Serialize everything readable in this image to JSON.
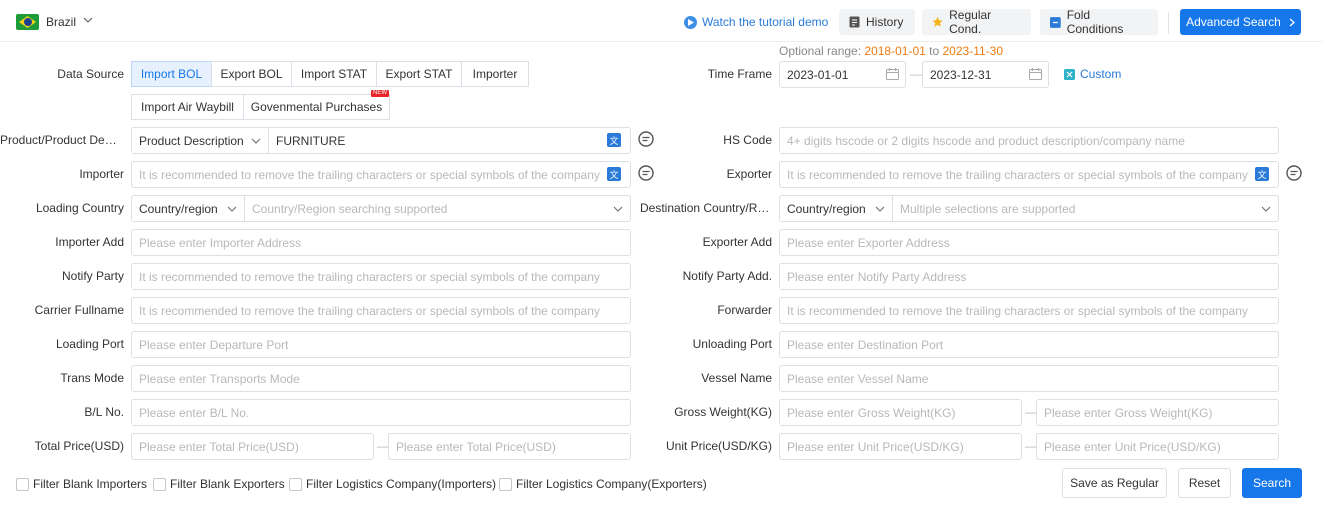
{
  "header": {
    "country": "Brazil",
    "tutorial_link": "Watch the tutorial demo",
    "history_label": "History",
    "regular_cond_label": "Regular Cond.",
    "fold_conditions_label": "Fold Conditions",
    "advanced_search_label": "Advanced Search"
  },
  "colors": {
    "primary": "#1677ea",
    "accent_orange": "#ee7b12",
    "active_bg": "#e6f1fd"
  },
  "data_source": {
    "label": "Data Source",
    "options": [
      "Import BOL",
      "Export BOL",
      "Import STAT",
      "Export STAT",
      "Importer",
      "Import Air Waybill",
      "Govenmental Purchases"
    ],
    "selected": "Import BOL",
    "new_badge": "NEW"
  },
  "time_frame": {
    "label": "Time Frame",
    "optional_label": "Optional range:",
    "range_start": "2018-01-01",
    "range_to": "to",
    "range_end": "2023-11-30",
    "start": "2023-01-01",
    "end": "2023-12-31",
    "dash": "—",
    "custom_label": "Custom"
  },
  "fields": {
    "product": {
      "label": "Product/Product Description",
      "select": "Product Description",
      "value": "FURNITURE"
    },
    "hs_code": {
      "label": "HS Code",
      "placeholder": "4+ digits hscode or 2 digits hscode and product description/company name"
    },
    "importer": {
      "label": "Importer",
      "placeholder": "It is recommended to remove the trailing characters or special symbols of the company"
    },
    "exporter": {
      "label": "Exporter",
      "placeholder": "It is recommended to remove the trailing characters or special symbols of the company"
    },
    "loading_country": {
      "label": "Loading Country",
      "select": "Country/region",
      "placeholder": "Country/Region searching supported"
    },
    "destination_country": {
      "label": "Destination Country/Region",
      "select": "Country/region",
      "placeholder": "Multiple selections are supported"
    },
    "importer_add": {
      "label": "Importer Add",
      "placeholder": "Please enter Importer Address"
    },
    "exporter_add": {
      "label": "Exporter Add",
      "placeholder": "Please enter Exporter Address"
    },
    "notify_party": {
      "label": "Notify Party",
      "placeholder": "It is recommended to remove the trailing characters or special symbols of the company"
    },
    "notify_party_add": {
      "label": "Notify Party Add.",
      "placeholder": "Please enter Notify Party Address"
    },
    "carrier_fullname": {
      "label": "Carrier Fullname",
      "placeholder": "It is recommended to remove the trailing characters or special symbols of the company"
    },
    "forwarder": {
      "label": "Forwarder",
      "placeholder": "It is recommended to remove the trailing characters or special symbols of the company"
    },
    "loading_port": {
      "label": "Loading Port",
      "placeholder": "Please enter Departure Port"
    },
    "unloading_port": {
      "label": "Unloading Port",
      "placeholder": "Please enter Destination Port"
    },
    "trans_mode": {
      "label": "Trans Mode",
      "placeholder": "Please enter Transports Mode"
    },
    "vessel_name": {
      "label": "Vessel Name",
      "placeholder": "Please enter Vessel Name"
    },
    "bl_no": {
      "label": "B/L No.",
      "placeholder": "Please enter B/L No."
    },
    "gross_weight": {
      "label": "Gross Weight(KG)",
      "placeholder": "Please enter Gross Weight(KG)"
    },
    "total_price": {
      "label": "Total Price(USD)",
      "placeholder": "Please enter Total Price(USD)"
    },
    "unit_price": {
      "label": "Unit Price(USD/KG)",
      "placeholder": "Please enter Unit Price(USD/KG)"
    }
  },
  "filters": {
    "blank_importers": "Filter Blank Importers",
    "blank_exporters": "Filter Blank Exporters",
    "logistics_importers": "Filter Logistics Company(Importers)",
    "logistics_exporters": "Filter Logistics Company(Exporters)"
  },
  "actions": {
    "save_regular": "Save as Regular",
    "reset": "Reset",
    "search": "Search"
  }
}
